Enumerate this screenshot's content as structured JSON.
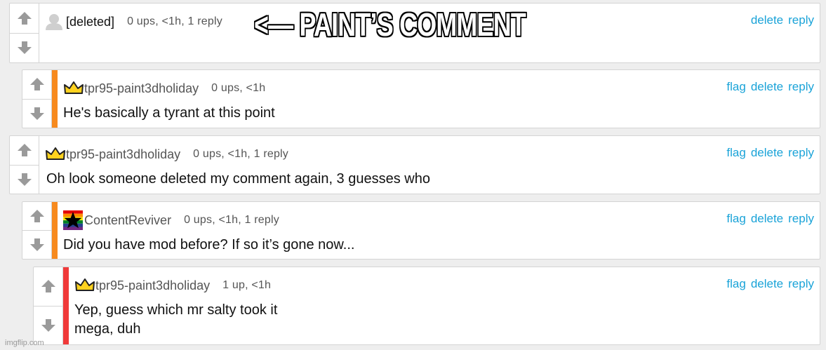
{
  "annotation": "<— PAINT’S COMMENT",
  "watermark": "imgflip.com",
  "colors": {
    "link": "#1aa3d8",
    "bar_orange": "#f78a1e",
    "bar_red": "#f03a3a",
    "crown": "#ffd21f"
  },
  "comments": [
    {
      "user": "[deleted]",
      "meta": "0 ups, <1h, 1 reply",
      "actions": [
        "delete",
        "reply"
      ],
      "text": "",
      "avatar_icon": "default-avatar-icon"
    },
    {
      "user": "tpr95-paint3dholiday",
      "meta": "0 ups, <1h",
      "actions": [
        "flag",
        "delete",
        "reply"
      ],
      "text": "He's basically a tyrant at this point",
      "avatar_icon": "crown-icon"
    },
    {
      "user": "tpr95-paint3dholiday",
      "meta": "0 ups, <1h, 1 reply",
      "actions": [
        "flag",
        "delete",
        "reply"
      ],
      "text": "Oh look someone deleted my comment again, 3 guesses who",
      "avatar_icon": "crown-icon"
    },
    {
      "user": "ContentReviver",
      "meta": "0 ups, <1h, 1 reply",
      "actions": [
        "flag",
        "delete",
        "reply"
      ],
      "text": "Did you have mod before? If so it’s gone now...",
      "avatar_icon": "rainbow-star-icon"
    },
    {
      "user": "tpr95-paint3dholiday",
      "meta": "1 up, <1h",
      "actions": [
        "flag",
        "delete",
        "reply"
      ],
      "text_lines": [
        "Yep, guess which mr salty took it",
        "mega, duh"
      ],
      "avatar_icon": "crown-icon"
    }
  ]
}
